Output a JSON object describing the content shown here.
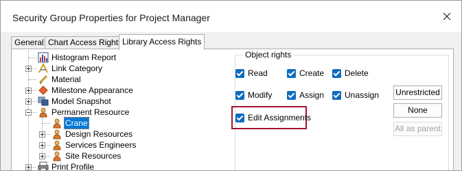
{
  "window": {
    "title": "Security Group Properties for Project Manager"
  },
  "tabs": [
    {
      "label": "General"
    },
    {
      "label": "Chart Access Rights"
    },
    {
      "label": "Library Access Rights"
    }
  ],
  "tree": {
    "items": [
      {
        "label": "Histogram Report",
        "icon": "histogram-report-icon"
      },
      {
        "label": "Link Category",
        "icon": "link-category-icon"
      },
      {
        "label": "Material",
        "icon": "material-icon"
      },
      {
        "label": "Milestone Appearance",
        "icon": "milestone-diamond-icon"
      },
      {
        "label": "Model Snapshot",
        "icon": "model-snapshot-icon"
      },
      {
        "label": "Permanent Resource",
        "icon": "person-icon"
      },
      {
        "label": "Crane",
        "icon": "person-icon"
      },
      {
        "label": "Design Resources",
        "icon": "person-icon"
      },
      {
        "label": "Services Engineers",
        "icon": "person-icon"
      },
      {
        "label": "Site Resources",
        "icon": "person-icon"
      },
      {
        "label": "Print Profile",
        "icon": "print-profile-icon"
      }
    ]
  },
  "object_rights": {
    "group_label": "Object rights",
    "read": "Read",
    "create": "Create",
    "delete": "Delete",
    "modify": "Modify",
    "assign": "Assign",
    "unassign": "Unassign",
    "edit_assignments": "Edit Assignments"
  },
  "buttons": {
    "unrestricted": "Unrestricted",
    "none": "None",
    "all_as_parent": "All as parent"
  },
  "colors": {
    "checkbox": "#0f6cbd",
    "highlight": "#a0132e",
    "selection": "#0078d7"
  }
}
